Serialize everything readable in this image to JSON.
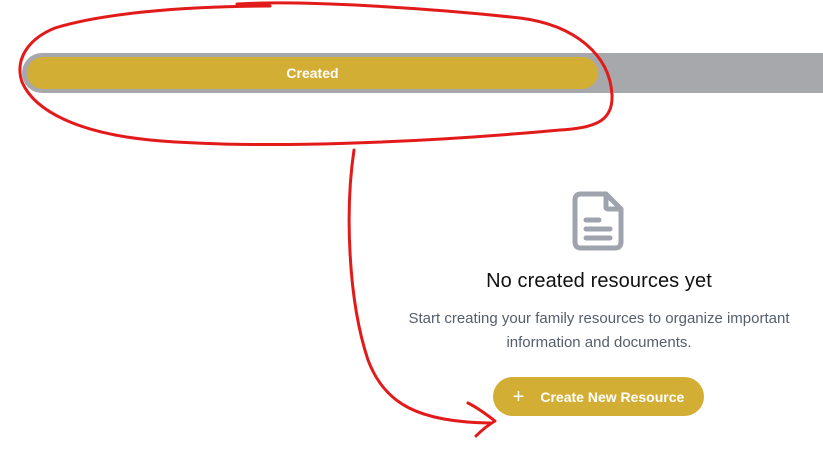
{
  "tabs": {
    "created_label": "Created"
  },
  "empty_state": {
    "icon": "document-icon",
    "title": "No created resources yet",
    "description": "Start creating your family resources to organize important information and documents.",
    "button_icon": "+",
    "button_label": "Create New Resource"
  },
  "colors": {
    "accent": "#d3ae35",
    "track": "#a7a8ab",
    "annotation": "#e21a1a"
  }
}
